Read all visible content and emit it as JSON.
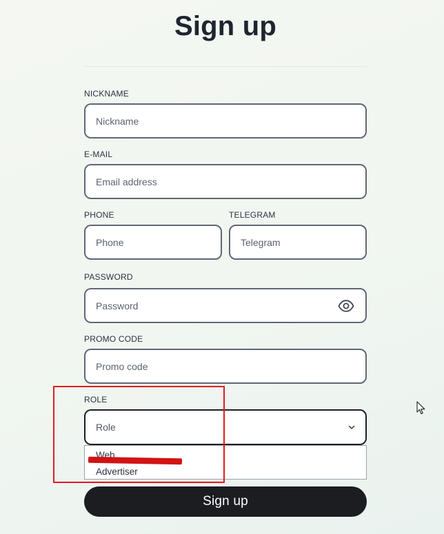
{
  "page": {
    "title": "Sign up"
  },
  "form": {
    "nickname": {
      "label": "NICKNAME",
      "placeholder": "Nickname",
      "value": ""
    },
    "email": {
      "label": "E-MAIL",
      "placeholder": "Email address",
      "value": ""
    },
    "phone": {
      "label": "PHONE",
      "placeholder": "Phone",
      "value": ""
    },
    "telegram": {
      "label": "TELEGRAM",
      "placeholder": "Telegram",
      "value": ""
    },
    "password": {
      "label": "PASSWORD",
      "placeholder": "Password",
      "value": "",
      "toggle_icon": "eye-icon"
    },
    "promo": {
      "label": "PROMO CODE",
      "placeholder": "Promo code",
      "value": ""
    },
    "role": {
      "label": "ROLE",
      "selected": "Role",
      "options": [
        "Web",
        "Advertiser"
      ],
      "icon": "chevron-down-icon"
    },
    "submit_label": "Sign up"
  },
  "annotation": {
    "highlight_color": "#e01b1b",
    "strike_color": "#d21313"
  }
}
